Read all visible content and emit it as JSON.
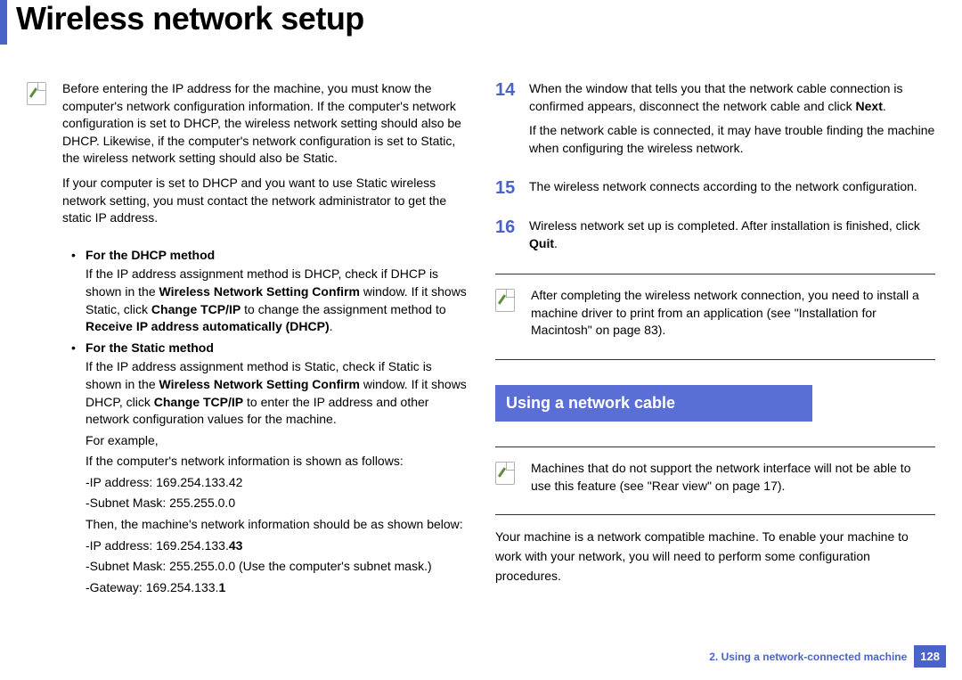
{
  "title": "Wireless network setup",
  "left": {
    "note1_p1": "Before entering the IP address for the machine, you must know the computer's network configuration information. If the computer's network configuration is set to DHCP, the wireless network setting should also be DHCP. Likewise, if the computer's network configuration is set to Static, the wireless network setting should also be Static.",
    "note1_p2": "If your computer is set to DHCP and you want to use Static wireless network setting, you must contact the network administrator to get the static IP address.",
    "dhcp_head": "For the DHCP method",
    "dhcp_body_a": "If the IP address assignment method is DHCP, check if DHCP is shown in the ",
    "dhcp_b1": "Wireless Network Setting Confirm",
    "dhcp_body_b": " window. If it shows Static, click ",
    "dhcp_b2": "Change TCP/IP",
    "dhcp_body_c": " to change the assignment method to ",
    "dhcp_b3": "Receive IP address automatically (DHCP)",
    "dhcp_body_d": ".",
    "static_head": "For the Static method",
    "static_body_a": "If the IP address assignment method is Static, check if Static is shown in the ",
    "static_b1": "Wireless Network Setting Confirm",
    "static_body_b": " window. If it shows DHCP, click ",
    "static_b2": "Change TCP/IP",
    "static_body_c": " to enter the IP address and other network configuration values for the machine.",
    "example_label": "For example,",
    "example_intro": "If the computer's network information is shown as follows:",
    "ex_ip": "-IP address: 169.254.133.42",
    "ex_subnet": "-Subnet Mask: 255.255.0.0",
    "ex_then": "Then, the machine's network information should be as shown below:",
    "ex_ip2_a": "-IP address: 169.254.133.",
    "ex_ip2_b": "43",
    "ex_subnet2": "-Subnet Mask: 255.255.0.0 (Use the computer's subnet mask.)",
    "ex_gw_a": "-Gateway: 169.254.133.",
    "ex_gw_b": "1"
  },
  "right": {
    "step14_num": "14",
    "step14_p1a": "When the window that tells you that the network cable connection is confirmed appears, disconnect the network cable and click ",
    "step14_p1b": "Next",
    "step14_p1c": ".",
    "step14_p2": "If the network cable is connected, it may have trouble finding the machine when configuring the wireless network.",
    "step15_num": "15",
    "step15_p": "The wireless network connects according to the network configuration.",
    "step16_num": "16",
    "step16_a": "Wireless network set up is completed. After installation is finished, click ",
    "step16_b": "Quit",
    "step16_c": ".",
    "note2": "After completing the wireless network connection, you need to install a machine driver to print from an application (see \"Installation for Macintosh\" on page 83).",
    "section_head": "Using a network cable",
    "note3": "Machines that do not support the network interface will not be able to use this feature (see \"Rear view\" on page 17).",
    "body": "Your machine is a network compatible machine. To enable your machine to work with your network, you will need to perform some configuration procedures."
  },
  "footer": {
    "chapter": "2.  Using a network-connected machine",
    "page": "128"
  }
}
